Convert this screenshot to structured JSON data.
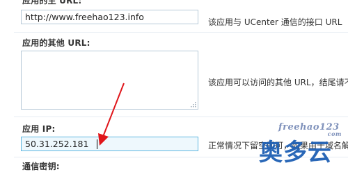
{
  "rows": [
    {
      "label": "应用的主 URL:",
      "value": "http://www.freehao123.info",
      "description": "该应用与 UCenter 通信的接口 URL"
    },
    {
      "label": "应用的其他 URL:",
      "value": "",
      "description": "该应用可以访问的其他 URL，结尾请不"
    },
    {
      "label": "应用 IP:",
      "value": "50.31.252.181",
      "description": "正常情况下留空即可，如果由于域名解"
    },
    {
      "label": "通信密钥:"
    }
  ],
  "watermark": {
    "top_text": "freehao123",
    "sub_text": "com",
    "main_text": "奥多云"
  },
  "colors": {
    "input_border": "#b7c9d8",
    "active_border": "#5db6e0",
    "arrow": "#e0161b",
    "watermark": "#1e5fb4"
  }
}
